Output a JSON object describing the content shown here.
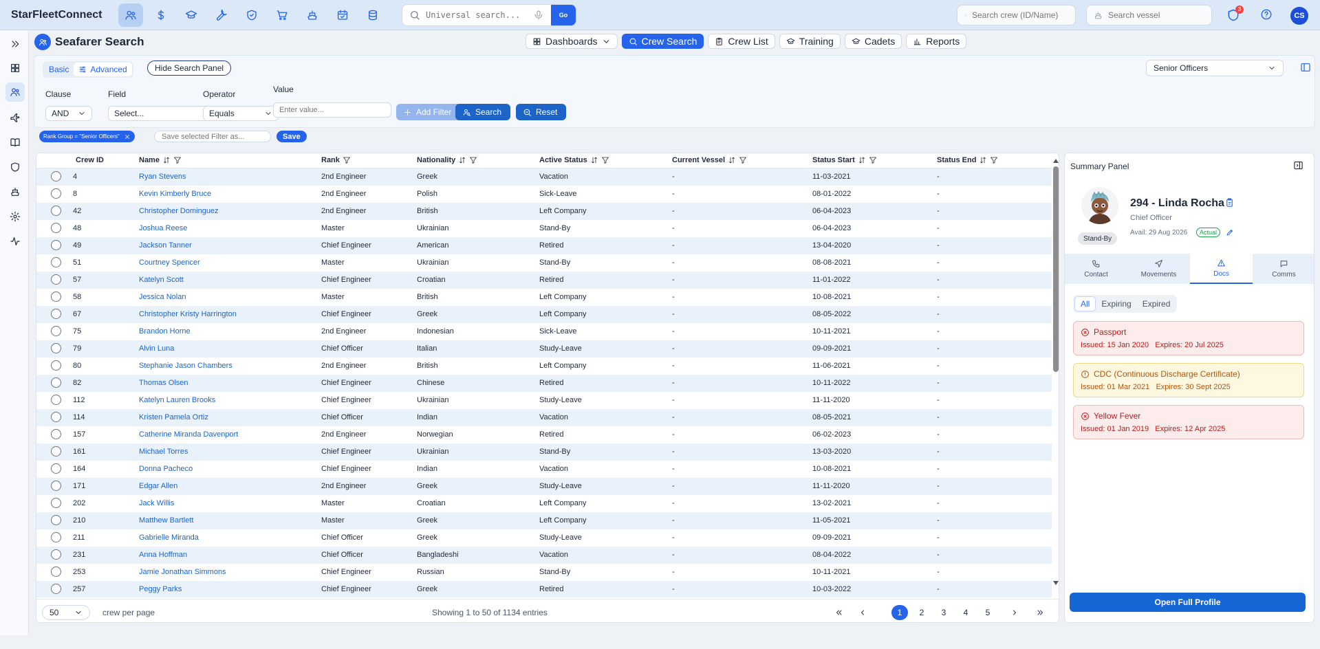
{
  "app": {
    "brand": "StarFleetConnect"
  },
  "topbar": {
    "modules": [
      {
        "name": "crew",
        "icon": "users-icon",
        "active": true
      },
      {
        "name": "finance",
        "icon": "dollar-icon",
        "active": false
      },
      {
        "name": "training",
        "icon": "graduation-cap-icon",
        "active": false
      },
      {
        "name": "technical",
        "icon": "wrench-icon",
        "active": false
      },
      {
        "name": "safety",
        "icon": "shield-icon",
        "active": false
      },
      {
        "name": "purchase",
        "icon": "cart-icon",
        "active": false
      },
      {
        "name": "vessel",
        "icon": "ship-icon",
        "active": false
      },
      {
        "name": "planner",
        "icon": "calendar-check-icon",
        "active": false
      },
      {
        "name": "database",
        "icon": "database-icon",
        "active": false
      }
    ],
    "universal_search_placeholder": "Universal search...",
    "go_label": "Go",
    "crew_search_placeholder": "Search crew (ID/Name)",
    "vessel_search_placeholder": "Search vessel",
    "notification_count": "3",
    "user_initials": "CS"
  },
  "sidebar": {
    "items": [
      {
        "icon": "expand-icon",
        "active": false
      },
      {
        "icon": "dashboard-icon",
        "active": false
      },
      {
        "icon": "users-icon",
        "active": true
      },
      {
        "icon": "plane-icon",
        "active": false
      },
      {
        "icon": "book-icon",
        "active": false
      },
      {
        "icon": "shield-icon",
        "active": false
      },
      {
        "icon": "ship-icon",
        "active": false
      },
      {
        "icon": "settings-icon",
        "active": false
      },
      {
        "icon": "activity-icon",
        "active": false
      }
    ]
  },
  "page": {
    "title": "Seafarer Search",
    "tabs": [
      {
        "label": "Dashboards",
        "icon": "grid-icon",
        "active": false,
        "dropdown": true
      },
      {
        "label": "Crew Search",
        "icon": "search-icon",
        "active": true
      },
      {
        "label": "Crew List",
        "icon": "clipboard-icon",
        "active": false
      },
      {
        "label": "Training",
        "icon": "graduation-cap-icon",
        "active": false
      },
      {
        "label": "Cadets",
        "icon": "graduation-cap-icon",
        "active": false
      },
      {
        "label": "Reports",
        "icon": "bar-chart-icon",
        "active": false
      }
    ]
  },
  "filters": {
    "mode_basic": "Basic",
    "mode_advanced": "Advanced",
    "hide_panel_label": "Hide Search Panel",
    "rank_group": "Senior Officers",
    "clause_label": "Clause",
    "clause_value": "AND",
    "field_label": "Field",
    "field_value": "Select...",
    "operator_label": "Operator",
    "operator_value": "Equals",
    "value_label": "Value",
    "value_placeholder": "Enter value...",
    "add_filter_label": "Add Filter",
    "search_label": "Search",
    "reset_label": "Reset",
    "active_chip": "Rank Group = \"Senior Officers\"",
    "save_filter_placeholder": "Save selected Filter as...",
    "save_label": "Save"
  },
  "table": {
    "columns": [
      "Crew ID",
      "Name",
      "Rank",
      "Nationality",
      "Active Status",
      "Current Vessel",
      "Status Start",
      "Status End"
    ],
    "rows": [
      {
        "id": "4",
        "name": "Ryan Stevens",
        "rank": "2nd Engineer",
        "nationality": "Greek",
        "status": "Vacation",
        "vessel": "-",
        "start": "11-03-2021",
        "end": "-"
      },
      {
        "id": "8",
        "name": "Kevin Kimberly Bruce",
        "rank": "2nd Engineer",
        "nationality": "Polish",
        "status": "Sick-Leave",
        "vessel": "-",
        "start": "08-01-2022",
        "end": "-"
      },
      {
        "id": "42",
        "name": "Christopher Dominguez",
        "rank": "2nd Engineer",
        "nationality": "British",
        "status": "Left Company",
        "vessel": "-",
        "start": "06-04-2023",
        "end": "-"
      },
      {
        "id": "48",
        "name": "Joshua Reese",
        "rank": "Master",
        "nationality": "Ukrainian",
        "status": "Stand-By",
        "vessel": "-",
        "start": "06-04-2023",
        "end": "-"
      },
      {
        "id": "49",
        "name": "Jackson Tanner",
        "rank": "Chief Engineer",
        "nationality": "American",
        "status": "Retired",
        "vessel": "-",
        "start": "13-04-2020",
        "end": "-"
      },
      {
        "id": "51",
        "name": "Courtney Spencer",
        "rank": "Master",
        "nationality": "Ukrainian",
        "status": "Stand-By",
        "vessel": "-",
        "start": "08-08-2021",
        "end": "-"
      },
      {
        "id": "57",
        "name": "Katelyn Scott",
        "rank": "Chief Engineer",
        "nationality": "Croatian",
        "status": "Retired",
        "vessel": "-",
        "start": "11-01-2022",
        "end": "-"
      },
      {
        "id": "58",
        "name": "Jessica Nolan",
        "rank": "Master",
        "nationality": "British",
        "status": "Left Company",
        "vessel": "-",
        "start": "10-08-2021",
        "end": "-"
      },
      {
        "id": "67",
        "name": "Christopher Kristy Harrington",
        "rank": "Chief Engineer",
        "nationality": "Greek",
        "status": "Left Company",
        "vessel": "-",
        "start": "08-05-2022",
        "end": "-"
      },
      {
        "id": "75",
        "name": "Brandon Horne",
        "rank": "2nd Engineer",
        "nationality": "Indonesian",
        "status": "Sick-Leave",
        "vessel": "-",
        "start": "10-11-2021",
        "end": "-"
      },
      {
        "id": "79",
        "name": "Alvin Luna",
        "rank": "Chief Officer",
        "nationality": "Italian",
        "status": "Study-Leave",
        "vessel": "-",
        "start": "09-09-2021",
        "end": "-"
      },
      {
        "id": "80",
        "name": "Stephanie Jason Chambers",
        "rank": "2nd Engineer",
        "nationality": "British",
        "status": "Left Company",
        "vessel": "-",
        "start": "11-06-2021",
        "end": "-"
      },
      {
        "id": "82",
        "name": "Thomas Olsen",
        "rank": "Chief Engineer",
        "nationality": "Chinese",
        "status": "Retired",
        "vessel": "-",
        "start": "10-11-2022",
        "end": "-"
      },
      {
        "id": "112",
        "name": "Katelyn Lauren Brooks",
        "rank": "Chief Engineer",
        "nationality": "Ukrainian",
        "status": "Study-Leave",
        "vessel": "-",
        "start": "11-11-2020",
        "end": "-"
      },
      {
        "id": "114",
        "name": "Kristen Pamela Ortiz",
        "rank": "Chief Officer",
        "nationality": "Indian",
        "status": "Vacation",
        "vessel": "-",
        "start": "08-05-2021",
        "end": "-"
      },
      {
        "id": "157",
        "name": "Catherine Miranda Davenport",
        "rank": "2nd Engineer",
        "nationality": "Norwegian",
        "status": "Retired",
        "vessel": "-",
        "start": "06-02-2023",
        "end": "-"
      },
      {
        "id": "161",
        "name": "Michael Torres",
        "rank": "Chief Engineer",
        "nationality": "Ukrainian",
        "status": "Stand-By",
        "vessel": "-",
        "start": "13-03-2020",
        "end": "-"
      },
      {
        "id": "164",
        "name": "Donna Pacheco",
        "rank": "Chief Engineer",
        "nationality": "Indian",
        "status": "Vacation",
        "vessel": "-",
        "start": "10-08-2021",
        "end": "-"
      },
      {
        "id": "171",
        "name": "Edgar Allen",
        "rank": "2nd Engineer",
        "nationality": "Greek",
        "status": "Study-Leave",
        "vessel": "-",
        "start": "11-11-2020",
        "end": "-"
      },
      {
        "id": "202",
        "name": "Jack Willis",
        "rank": "Master",
        "nationality": "Croatian",
        "status": "Left Company",
        "vessel": "-",
        "start": "13-02-2021",
        "end": "-"
      },
      {
        "id": "210",
        "name": "Matthew Bartlett",
        "rank": "Master",
        "nationality": "Greek",
        "status": "Left Company",
        "vessel": "-",
        "start": "11-05-2021",
        "end": "-"
      },
      {
        "id": "211",
        "name": "Gabrielle Miranda",
        "rank": "Chief Officer",
        "nationality": "Greek",
        "status": "Study-Leave",
        "vessel": "-",
        "start": "09-09-2021",
        "end": "-"
      },
      {
        "id": "231",
        "name": "Anna Hoffman",
        "rank": "Chief Officer",
        "nationality": "Bangladeshi",
        "status": "Vacation",
        "vessel": "-",
        "start": "08-04-2022",
        "end": "-"
      },
      {
        "id": "253",
        "name": "Jamie Jonathan Simmons",
        "rank": "Chief Engineer",
        "nationality": "Russian",
        "status": "Stand-By",
        "vessel": "-",
        "start": "10-11-2021",
        "end": "-"
      },
      {
        "id": "257",
        "name": "Peggy Parks",
        "rank": "Chief Engineer",
        "nationality": "Greek",
        "status": "Retired",
        "vessel": "-",
        "start": "10-03-2022",
        "end": "-"
      }
    ],
    "scroll_position": 0,
    "per_page": "50",
    "per_page_label": "crew per page",
    "entries_text": "Showing 1 to 50 of 1134 entries",
    "pages": [
      "1",
      "2",
      "3",
      "4",
      "5"
    ],
    "current_page": "1"
  },
  "summary": {
    "title": "Summary Panel",
    "name": "294 - Linda Rocha",
    "role": "Chief Officer",
    "availability": "Avail: 29 Aug 2026",
    "availability_badge": "Actual",
    "status": "Stand-By",
    "tabs": [
      {
        "label": "Contact",
        "icon": "phone-icon",
        "active": false
      },
      {
        "label": "Movements",
        "icon": "navigation-icon",
        "active": false
      },
      {
        "label": "Docs",
        "icon": "warning-icon",
        "active": true
      },
      {
        "label": "Comms",
        "icon": "message-icon",
        "active": false
      }
    ],
    "doc_filters": [
      {
        "label": "All",
        "active": true
      },
      {
        "label": "Expiring",
        "active": false
      },
      {
        "label": "Expired",
        "active": false
      }
    ],
    "documents": [
      {
        "title": "Passport",
        "issued": "Issued: 15 Jan 2020",
        "expires": "Expires: 20 Jul 2025",
        "state": "expired",
        "color": "#b91c1c"
      },
      {
        "title": "CDC (Continuous Discharge Certificate)",
        "issued": "Issued: 01 Mar 2021",
        "expires": "Expires: 30 Sept 2025",
        "state": "expiring",
        "color": "#b45309"
      },
      {
        "title": "Yellow Fever",
        "issued": "Issued: 01 Jan 2019",
        "expires": "Expires: 12 Apr 2025",
        "state": "expired",
        "color": "#b91c1c"
      }
    ],
    "open_profile_label": "Open Full Profile"
  },
  "colors": {
    "accent": "#2563eb",
    "topbar": "#dbe8f8",
    "row_alt": "#e9f1fb",
    "link": "#1d64c8"
  }
}
